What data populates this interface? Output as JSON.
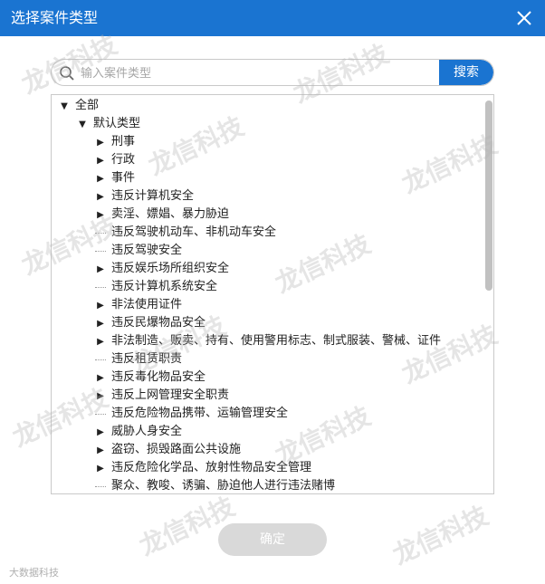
{
  "dialog": {
    "title": "选择案件类型",
    "close_icon": "close-icon"
  },
  "search": {
    "placeholder": "输入案件类型",
    "button_label": "搜索"
  },
  "tree": {
    "rows": [
      {
        "label": "全部",
        "toggle": "▼",
        "level": 0
      },
      {
        "label": "默认类型",
        "toggle": "▼",
        "level": 1
      },
      {
        "label": "刑事",
        "toggle": "▶",
        "level": 2
      },
      {
        "label": "行政",
        "toggle": "▶",
        "level": 2
      },
      {
        "label": "事件",
        "toggle": "▶",
        "level": 2
      },
      {
        "label": "违反计算机安全",
        "toggle": "▶",
        "level": 2
      },
      {
        "label": "卖淫、嫖娼、暴力胁迫",
        "toggle": "▶",
        "level": 2
      },
      {
        "label": "违反驾驶机动车、非机动车安全",
        "toggle": "",
        "level": 2
      },
      {
        "label": "违反驾驶安全",
        "toggle": "",
        "level": 2
      },
      {
        "label": "违反娱乐场所组织安全",
        "toggle": "▶",
        "level": 2
      },
      {
        "label": "违反计算机系统安全",
        "toggle": "",
        "level": 2
      },
      {
        "label": "非法使用证件",
        "toggle": "▶",
        "level": 2
      },
      {
        "label": "违反民爆物品安全",
        "toggle": "▶",
        "level": 2
      },
      {
        "label": "非法制造、贩卖、持有、使用警用标志、制式服装、警械、证件",
        "toggle": "▶",
        "level": 2
      },
      {
        "label": "违反租赁职责",
        "toggle": "",
        "level": 2
      },
      {
        "label": "违反毒化物品安全",
        "toggle": "▶",
        "level": 2
      },
      {
        "label": "违反上网管理安全职责",
        "toggle": "▶",
        "level": 2
      },
      {
        "label": "违反危险物品携带、运输管理安全",
        "toggle": "",
        "level": 2
      },
      {
        "label": "威胁人身安全",
        "toggle": "▶",
        "level": 2
      },
      {
        "label": "盗窃、损毁路面公共设施",
        "toggle": "▶",
        "level": 2
      },
      {
        "label": "违反危险化学品、放射性物品安全管理",
        "toggle": "▶",
        "level": 2
      },
      {
        "label": "聚众、教唆、诱骗、胁迫他人进行违法赌博",
        "toggle": "",
        "level": 2
      }
    ]
  },
  "footer": {
    "confirm_label": "确定"
  },
  "watermark": {
    "text": "龙信科技",
    "source_text": "大数据科技"
  },
  "colors": {
    "accent": "#1a74d1",
    "disabled_button": "#d9d9d9"
  }
}
